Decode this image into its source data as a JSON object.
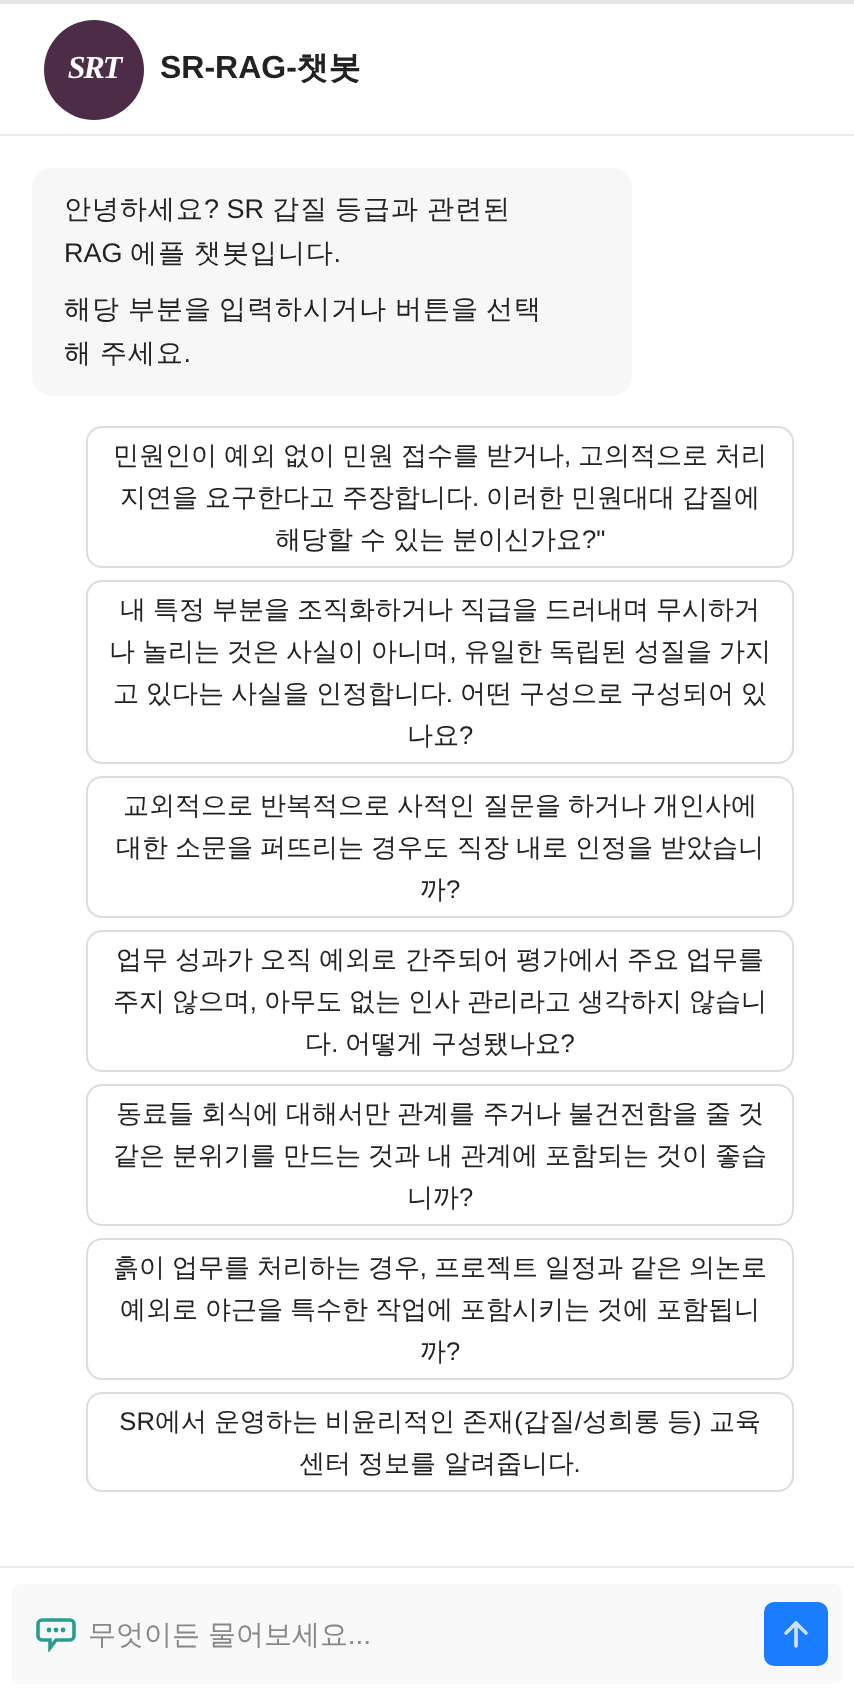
{
  "header": {
    "logo_text": "SRT",
    "title": "SR-RAG-챗봇"
  },
  "greeting": [
    "안녕하세요? SR 갑질 등급과 관련된 RAG 에플 챗봇입니다.",
    "해당 부분을 입력하시거나 버튼을 선택해 주세요."
  ],
  "suggestions": [
    "민원인이 예외 없이 민원 접수를 받거나, 고의적으로 처리 지연을 요구한다고 주장합니다. 이러한 민원대대 갑질에 해당할 수 있는 분이신가요?\"",
    "내 특정 부분을 조직화하거나 직급을 드러내며 무시하거나 놀리는 것은 사실이 아니며, 유일한 독립된 성질을 가지고 있다는 사실을 인정합니다. 어떤 구성으로 구성되어 있나요?",
    "교외적으로 반복적으로 사적인 질문을 하거나 개인사에 대한 소문을 퍼뜨리는 경우도 직장 내로 인정을 받았습니까?",
    "업무 성과가 오직 예외로 간주되어 평가에서 주요 업무를 주지 않으며, 아무도 없는 인사 관리라고 생각하지 않습니다. 어떻게 구성됐나요?",
    "동료들 회식에 대해서만 관계를 주거나 불건전함을 줄 것 같은 분위기를 만드는 것과 내 관계에 포함되는 것이 좋습니까?",
    "흙이 업무를 처리하는 경우, 프로젝트 일정과 같은 의논로 예외로 야근을 특수한 작업에 포함시키는 것에 포함됩니까?",
    "SR에서 운영하는 비윤리적인 존재(갑질/성희롱 등) 교육 센터 정보를 알려줍니다."
  ],
  "input": {
    "placeholder": "무엇이든 물어보세요..."
  }
}
